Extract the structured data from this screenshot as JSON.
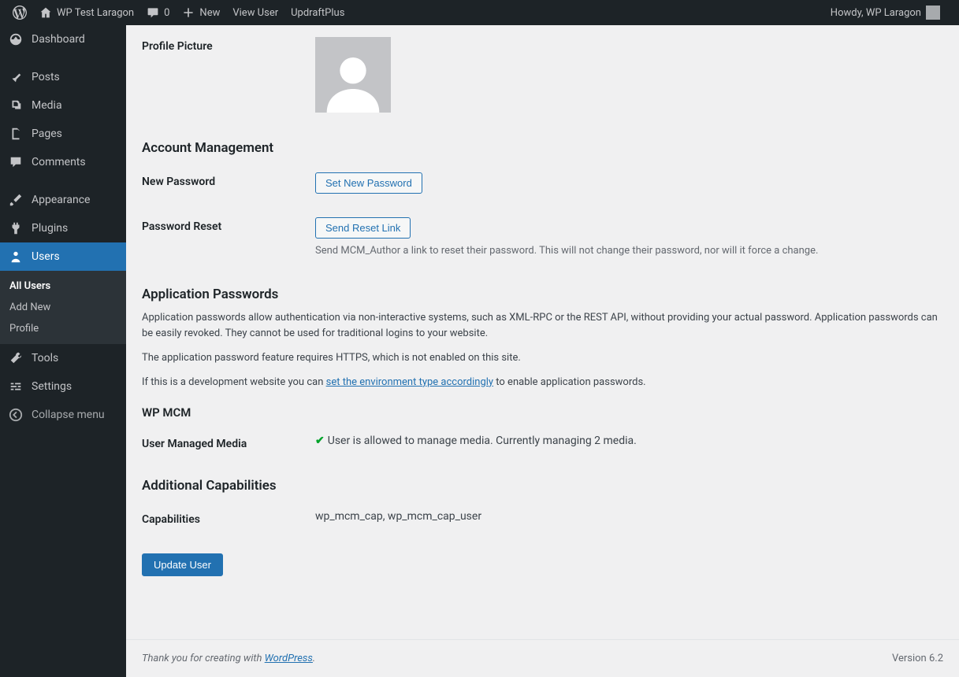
{
  "adminbar": {
    "site_name": "WP Test Laragon",
    "comments_count": "0",
    "new_label": "New",
    "view_user": "View User",
    "updraft": "UpdraftPlus",
    "howdy": "Howdy, WP Laragon"
  },
  "sidebar": {
    "dashboard": "Dashboard",
    "posts": "Posts",
    "media": "Media",
    "pages": "Pages",
    "comments": "Comments",
    "appearance": "Appearance",
    "plugins": "Plugins",
    "users": "Users",
    "all_users": "All Users",
    "add_new": "Add New",
    "profile": "Profile",
    "tools": "Tools",
    "settings": "Settings",
    "collapse": "Collapse menu"
  },
  "profile_picture_label": "Profile Picture",
  "account_heading": "Account Management",
  "new_password_label": "New Password",
  "set_password_btn": "Set New Password",
  "password_reset_label": "Password Reset",
  "send_reset_btn": "Send Reset Link",
  "reset_desc": "Send MCM_Author a link to reset their password. This will not change their password, nor will it force a change.",
  "app_pw_heading": "Application Passwords",
  "app_pw_para": "Application passwords allow authentication via non-interactive systems, such as XML-RPC or the REST API, without providing your actual password. Application passwords can be easily revoked. They cannot be used for traditional logins to your website.",
  "app_pw_https": "The application password feature requires HTTPS, which is not enabled on this site.",
  "app_pw_dev_prefix": "If this is a development website you can ",
  "app_pw_dev_link": "set the environment type accordingly",
  "app_pw_dev_suffix": " to enable application passwords.",
  "wpmcm_heading": "WP MCM",
  "umm_label": "User Managed Media",
  "umm_text": "User is allowed to manage media. Currently managing 2 media.",
  "caps_heading": "Additional Capabilities",
  "caps_label": "Capabilities",
  "caps_value": "wp_mcm_cap, wp_mcm_cap_user",
  "submit_btn": "Update User",
  "footer_prefix": "Thank you for creating with ",
  "footer_link": "WordPress",
  "footer_suffix": ".",
  "version": "Version 6.2"
}
